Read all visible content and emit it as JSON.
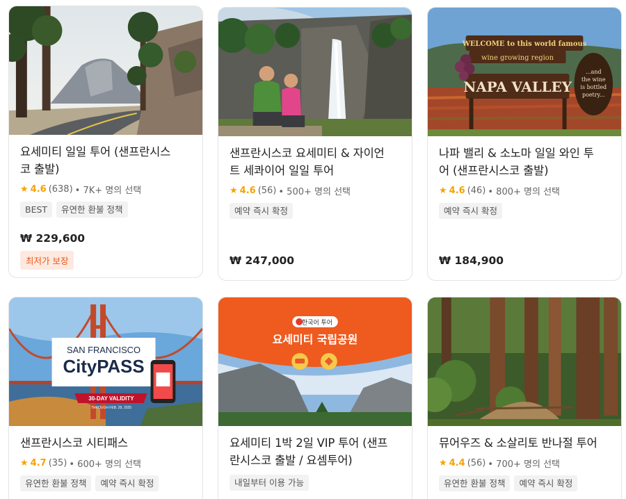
{
  "cards": [
    {
      "title": "요세미티 일일 투어 (샌프란시스코 출발)",
      "title_line1": "요세미티 일일 투어 (샌프란시스",
      "title_line2": "코 출발)",
      "star": "★",
      "score": "4.6",
      "reviews": "(638)",
      "popularity": "• 7K+ 명의 선택",
      "tags": [
        "BEST",
        "유연한 환불 정책"
      ],
      "price": "₩ 229,600",
      "promo": "최저가 보장"
    },
    {
      "title_line1": "샌프란시스코 요세미티 & 자이언",
      "title_line2": "트 세콰이어 일일 투어",
      "star": "★",
      "score": "4.6",
      "reviews": "(56)",
      "popularity": "• 500+ 명의 선택",
      "tags": [
        "예약 즉시 확정"
      ],
      "price": "₩ 247,000"
    },
    {
      "title_line1": "나파 밸리 & 소노마 일일 와인 투",
      "title_line2": "어 (샌프란시스코 출발)",
      "star": "★",
      "score": "4.6",
      "reviews": "(46)",
      "popularity": "• 800+ 명의 선택",
      "tags": [
        "예약 즉시 확정"
      ],
      "price": "₩ 184,900",
      "image_text": {
        "line1": "WELCOME to this world famous",
        "line2": "wine growing region",
        "line3": "NAPA VALLEY",
        "side1": "...and",
        "side2": "the wine",
        "side3": "is bottled",
        "side4": "poetry..."
      }
    },
    {
      "title_line1": "샌프란시스코 시티패스",
      "title_line2": "",
      "star": "★",
      "score": "4.7",
      "reviews": "(35)",
      "popularity": "• 600+ 명의 선택",
      "tags": [
        "유연한 환불 정책",
        "예약 즉시 확정"
      ],
      "image_text": {
        "brand_top": "SAN FRANCISCO",
        "brand_main": "CityPASS",
        "ribbon": "30-DAY VALIDITY",
        "ribbon_sub": "THROUGH FEB. 28, 2025"
      }
    },
    {
      "title_line1": "요세미티 1박 2일 VIP 투어 (샌프",
      "title_line2": "란시스코 출발 / 요셈투어)",
      "star": "★",
      "score": "",
      "reviews": "",
      "popularity": "",
      "tags": [
        "내일부터 이용 가능"
      ],
      "image_text": {
        "badge": "한국어 투어",
        "headline": "요세미티 국립공원"
      }
    },
    {
      "title_line1": "뮤어우즈 & 소살리토 반나절 투어",
      "title_line2": "",
      "star": "★",
      "score": "4.4",
      "reviews": "(56)",
      "popularity": "• 700+ 명의 선택",
      "tags": [
        "유연한 환불 정책",
        "예약 즉시 확정"
      ]
    }
  ],
  "colors": {
    "star": "#f5a300",
    "promo_bg": "#fde9e0",
    "promo_text": "#e85a1c",
    "tag_bg": "#f2f2f2",
    "orange_banner": "#ef5a1e"
  }
}
